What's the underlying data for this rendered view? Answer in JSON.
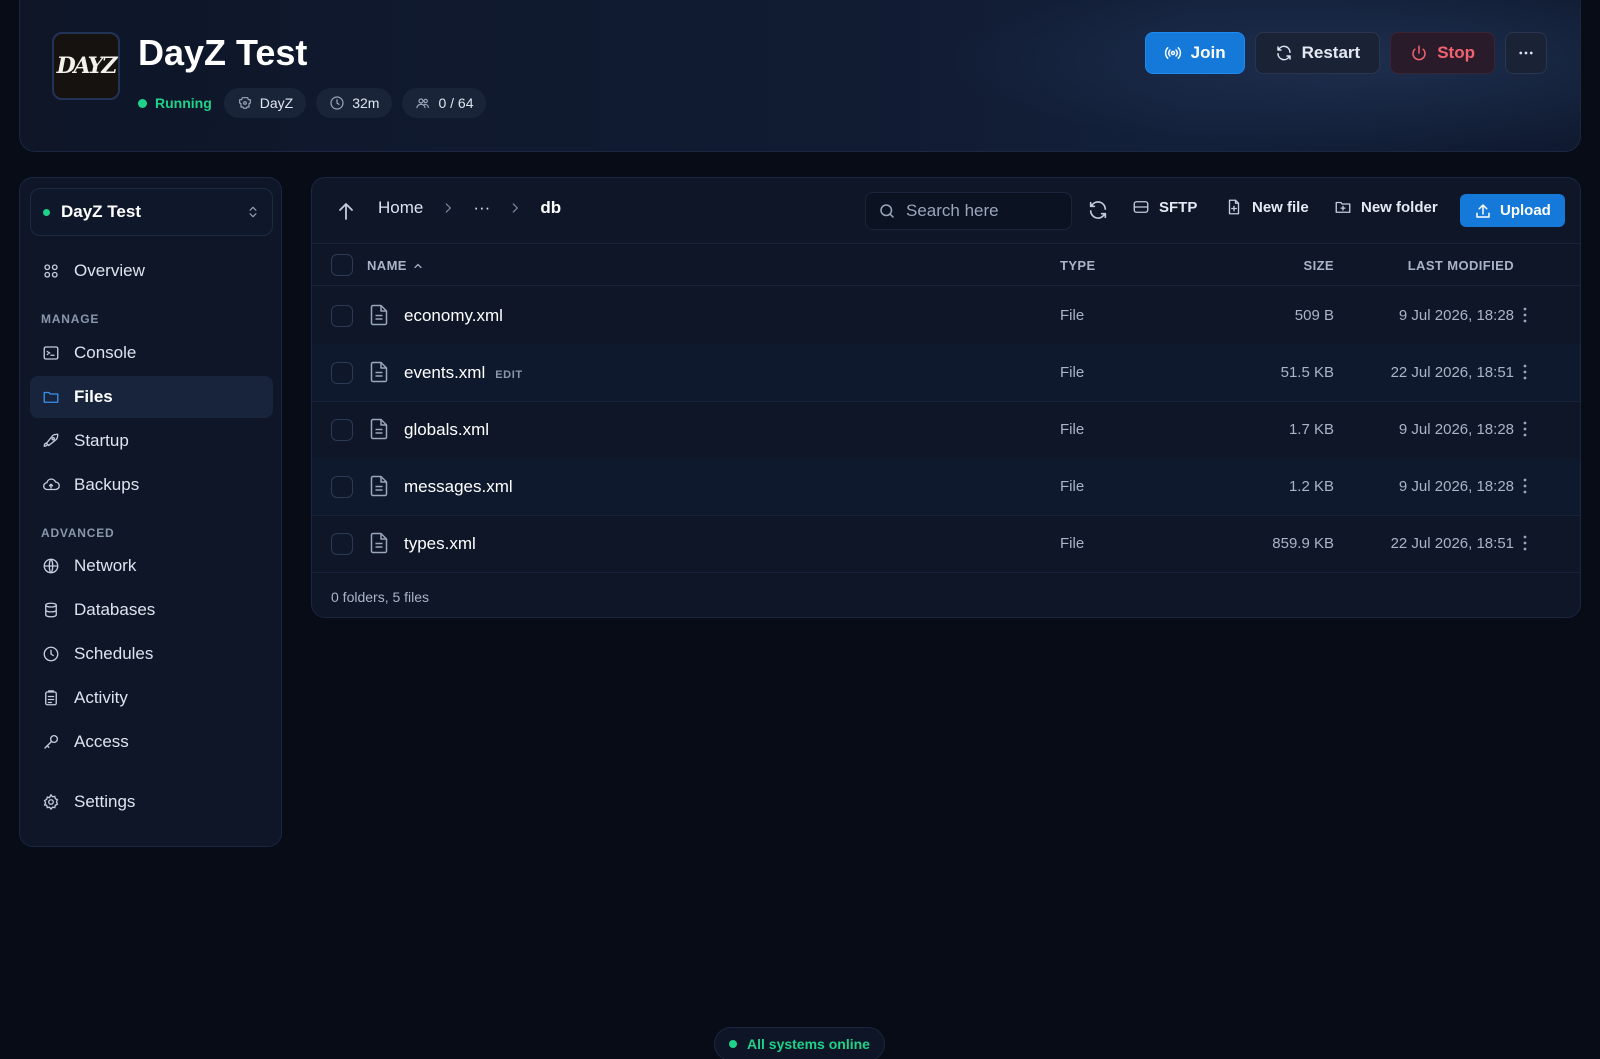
{
  "server": {
    "logo_text": "DAYZ",
    "title": "DayZ Test",
    "status": "Running",
    "chips": [
      {
        "icon": "game-icon",
        "label": "DayZ"
      },
      {
        "icon": "clock-icon",
        "label": "32m"
      },
      {
        "icon": "players-icon",
        "label": "0 / 64"
      }
    ]
  },
  "actions": {
    "join": "Join",
    "restart": "Restart",
    "stop": "Stop",
    "more_icon": "more-horizontal-icon"
  },
  "sidebar": {
    "server_name": "DayZ Test",
    "overview": "Overview",
    "sections": {
      "manage": "MANAGE",
      "advanced": "ADVANCED"
    },
    "manage_items": [
      {
        "label": "Console",
        "icon": "terminal-icon"
      },
      {
        "label": "Files",
        "icon": "folder-icon",
        "active": true
      },
      {
        "label": "Startup",
        "icon": "rocket-icon"
      },
      {
        "label": "Backups",
        "icon": "cloud-upload-icon"
      }
    ],
    "advanced_items": [
      {
        "label": "Network",
        "icon": "globe-icon"
      },
      {
        "label": "Databases",
        "icon": "database-icon"
      },
      {
        "label": "Schedules",
        "icon": "clock-icon"
      },
      {
        "label": "Activity",
        "icon": "clipboard-icon"
      },
      {
        "label": "Access",
        "icon": "key-icon"
      }
    ],
    "settings": "Settings"
  },
  "files": {
    "breadcrumb": [
      "Home",
      "···",
      "db"
    ],
    "search_placeholder": "Search here",
    "toolbar": {
      "sftp": "SFTP",
      "new_file": "New file",
      "new_folder": "New folder",
      "upload": "Upload"
    },
    "columns": {
      "name": "NAME",
      "type": "TYPE",
      "size": "SIZE",
      "modified": "LAST MODIFIED"
    },
    "rows": [
      {
        "name": "economy.xml",
        "tag": "",
        "type": "File",
        "size": "509 B",
        "modified": "9 Jul 2026, 18:28"
      },
      {
        "name": "events.xml",
        "tag": "EDIT",
        "type": "File",
        "size": "51.5 KB",
        "modified": "22 Jul 2026, 18:51"
      },
      {
        "name": "globals.xml",
        "tag": "",
        "type": "File",
        "size": "1.7 KB",
        "modified": "9 Jul 2026, 18:28"
      },
      {
        "name": "messages.xml",
        "tag": "",
        "type": "File",
        "size": "1.2 KB",
        "modified": "9 Jul 2026, 18:28"
      },
      {
        "name": "types.xml",
        "tag": "",
        "type": "File",
        "size": "859.9 KB",
        "modified": "22 Jul 2026, 18:51"
      }
    ],
    "summary": "0 folders, 5 files"
  },
  "system_status": "All systems online",
  "colors": {
    "accent": "#1479d8",
    "online": "#1fd189",
    "danger": "#f26371",
    "background": "#070c17",
    "panel": "#0e1628"
  }
}
